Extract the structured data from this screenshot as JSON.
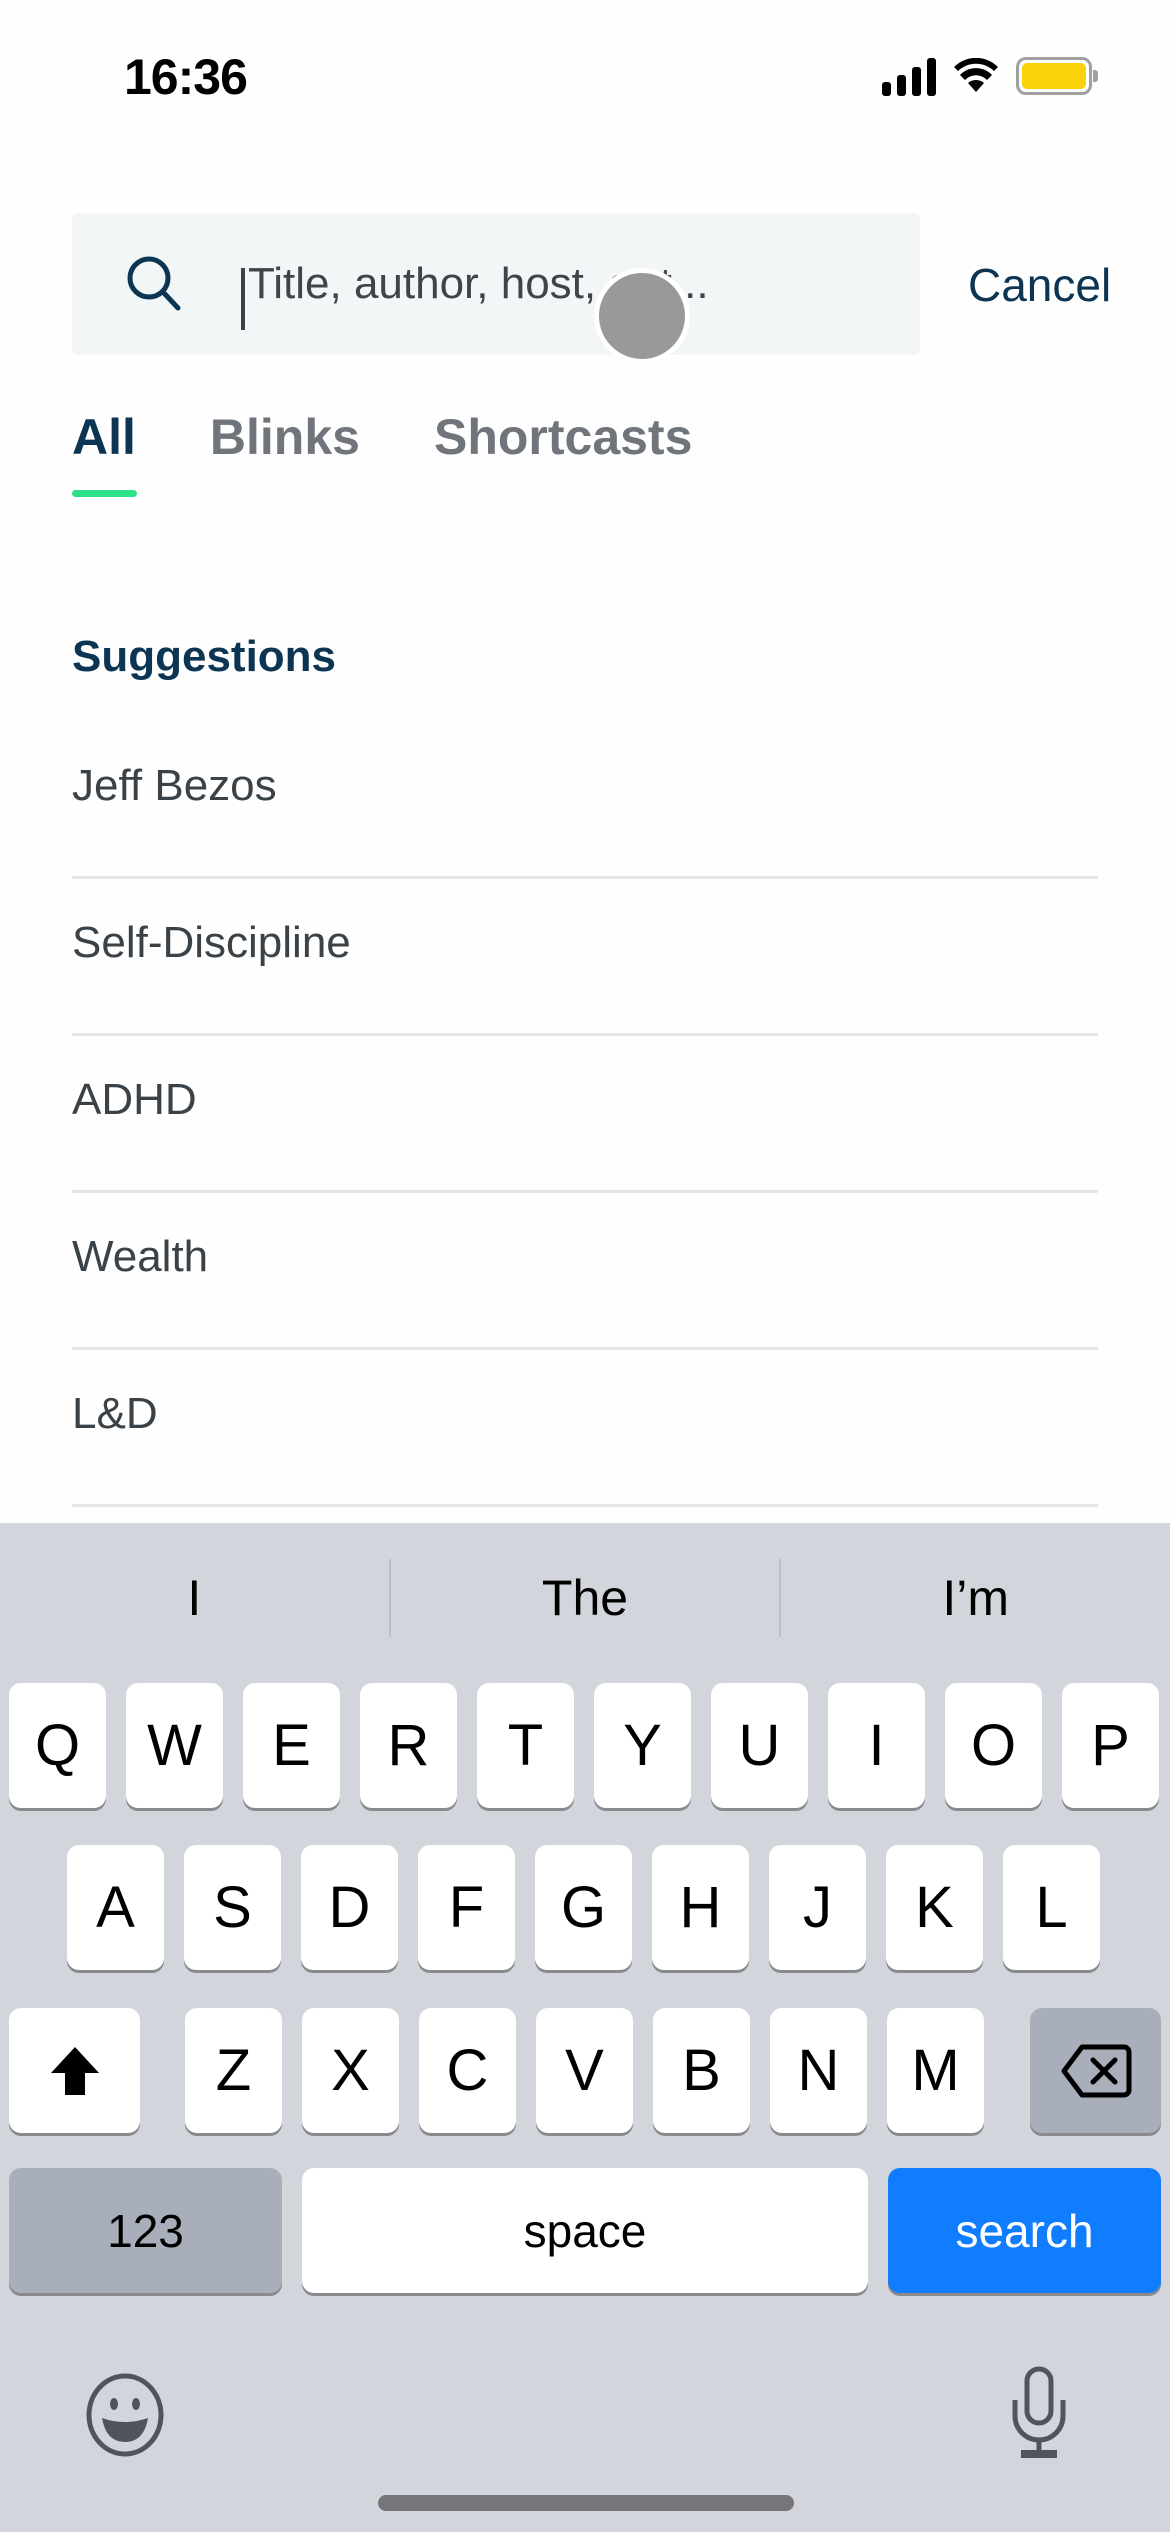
{
  "status_bar": {
    "time": "16:36",
    "icons": [
      "cellular-signal-icon",
      "wifi-icon",
      "battery-icon"
    ],
    "battery_color": "#fbd30b"
  },
  "search": {
    "placeholder": "Title, author, host, or t...",
    "value": "",
    "icon": "search-icon",
    "cancel_label": "Cancel"
  },
  "tabs": [
    {
      "label": "All",
      "active": true
    },
    {
      "label": "Blinks",
      "active": false
    },
    {
      "label": "Shortcasts",
      "active": false
    }
  ],
  "colors": {
    "accent_green": "#2ee087",
    "navy": "#0c3553",
    "keyboard_blue": "#0f7dfe"
  },
  "suggestions": {
    "title": "Suggestions",
    "items": [
      "Jeff Bezos",
      "Self-Discipline",
      "ADHD",
      "Wealth",
      "L&D"
    ]
  },
  "keyboard": {
    "predictions": [
      "I",
      "The",
      "I’m"
    ],
    "row1": [
      "Q",
      "W",
      "E",
      "R",
      "T",
      "Y",
      "U",
      "I",
      "O",
      "P"
    ],
    "row2": [
      "A",
      "S",
      "D",
      "F",
      "G",
      "H",
      "J",
      "K",
      "L"
    ],
    "row3": [
      "Z",
      "X",
      "C",
      "V",
      "B",
      "N",
      "M"
    ],
    "numbers_label": "123",
    "space_label": "space",
    "action_label": "search"
  }
}
